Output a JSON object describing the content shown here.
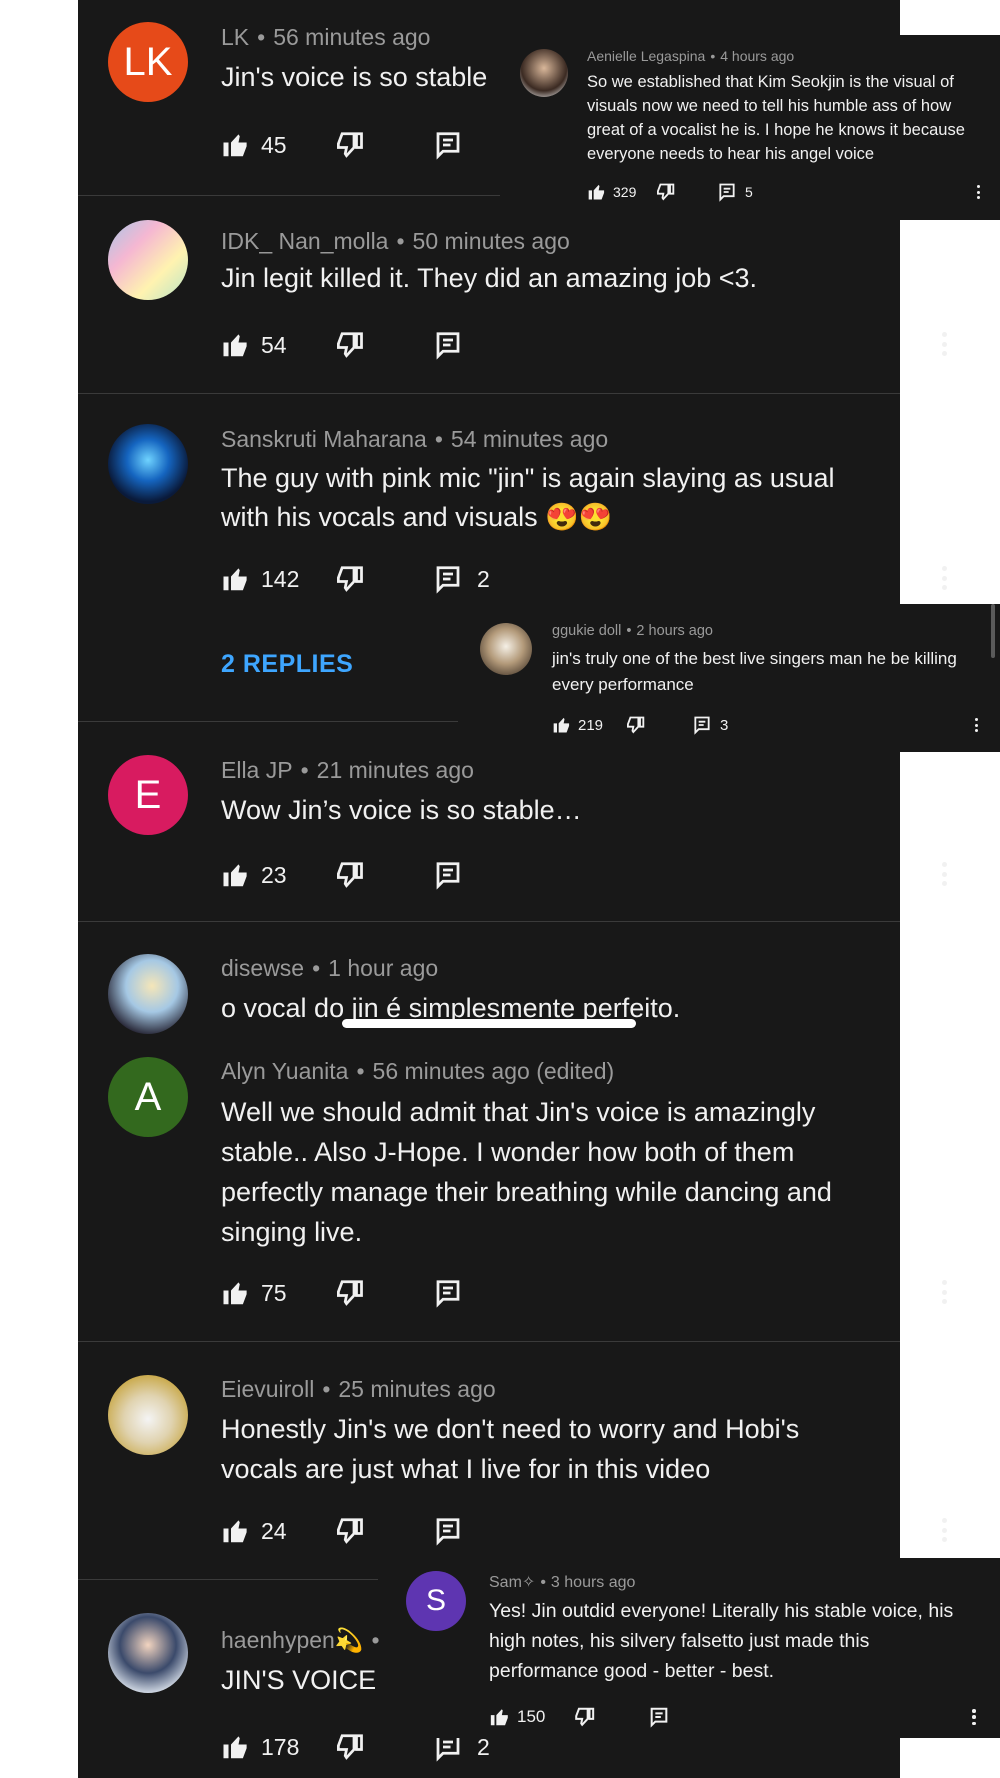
{
  "comments": [
    {
      "author": "LK",
      "time": "56 minutes ago",
      "text": "Jin's voice is so stable",
      "likes": "45",
      "avatar_letter": "LK",
      "avatar_color": "#e64a19"
    },
    {
      "author": "IDK_ Nan_molla",
      "time": "50 minutes ago",
      "text": "Jin legit killed it. They did an amazing job <3.",
      "likes": "54"
    },
    {
      "author": "Sanskruti Maharana",
      "time": "54 minutes ago",
      "text": "The guy with pink mic \"jin\" is again slaying as usual with his vocals and visuals 😍😍",
      "likes": "142",
      "replies": "2",
      "replies_link": "2 REPLIES"
    },
    {
      "author": "Ella JP",
      "time": "21 minutes ago",
      "text": "Wow Jin’s voice is so stable…",
      "likes": "23",
      "avatar_letter": "E",
      "avatar_color": "#d81b60"
    },
    {
      "author": "disewse",
      "time": "1 hour ago",
      "text": "o vocal do jin é simplesmente perfeito."
    },
    {
      "author": "Alyn Yuanita",
      "time": "56 minutes ago (edited)",
      "text": "Well we should admit that Jin's voice is amazingly stable.. Also J-Hope. I wonder how both of them perfectly manage their breathing while dancing and singing live.",
      "likes": "75",
      "avatar_letter": "A",
      "avatar_color": "#33691e"
    },
    {
      "author": "Eievuiroll",
      "time": "25 minutes ago",
      "text": "Honestly Jin's we don't need to worry and Hobi's vocals are just what I live for in this video",
      "likes": "24"
    },
    {
      "author": "haenhypen💫",
      "time": "",
      "text": "JIN'S VOICE I",
      "likes": "178",
      "replies": "2"
    }
  ],
  "overlays": [
    {
      "author": "Aenielle Legaspina",
      "time": "4 hours ago",
      "text": "So we established that Kim Seokjin is the visual of visuals now we need to tell his humble ass of how great of a vocalist he is. I hope he knows it because everyone needs to hear his angel voice",
      "likes": "329",
      "replies": "5"
    },
    {
      "author": "ggukie doll",
      "time": "2 hours ago",
      "text": "jin's truly one of the best live singers man he be killing every performance",
      "likes": "219",
      "replies": "3"
    },
    {
      "author": "Sam✧",
      "time": "3 hours ago",
      "text": "Yes! Jin outdid everyone! Literally his stable voice, his high notes, his silvery falsetto just made this performance good - better - best.",
      "likes": "150",
      "avatar_letter": "S",
      "avatar_color": "#5e35b1"
    }
  ],
  "icons": [
    "thumbs-up-icon",
    "thumbs-down-icon",
    "reply-icon",
    "more-vert-icon"
  ]
}
